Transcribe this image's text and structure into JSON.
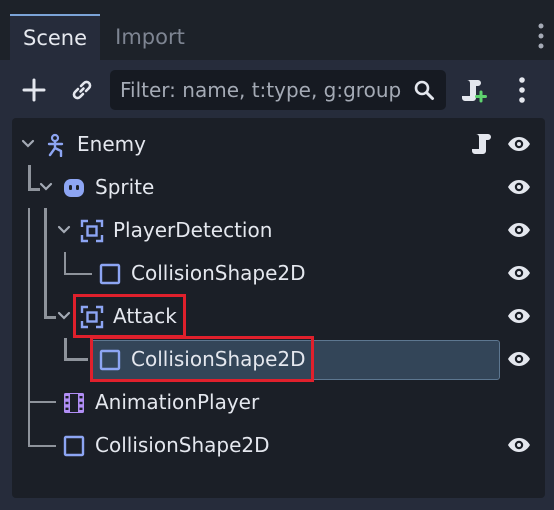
{
  "tabs": [
    {
      "label": "Scene",
      "active": true
    },
    {
      "label": "Import",
      "active": false
    }
  ],
  "toolbar": {
    "add_icon": "plus-icon",
    "link_icon": "link-icon",
    "filter_placeholder": "Filter: name, t:type, g:group",
    "search_icon": "search-icon",
    "add_script_icon": "add-script-icon",
    "menu_icon": "kebab-menu-icon"
  },
  "tree": {
    "nodes": [
      {
        "label": "Enemy",
        "type_icon": "character-body-icon",
        "has_script": true,
        "visible_toggle": true
      },
      {
        "label": "Sprite",
        "type_icon": "sprite-icon",
        "visible_toggle": true
      },
      {
        "label": "PlayerDetection",
        "type_icon": "area2d-icon",
        "visible_toggle": true
      },
      {
        "label": "CollisionShape2D",
        "type_icon": "collision-shape-icon",
        "visible_toggle": true
      },
      {
        "label": "Attack",
        "type_icon": "area2d-icon",
        "visible_toggle": true,
        "highlighted": true
      },
      {
        "label": "CollisionShape2D",
        "type_icon": "collision-shape-icon",
        "visible_toggle": true,
        "selected": true,
        "highlighted": true
      },
      {
        "label": "AnimationPlayer",
        "type_icon": "animation-player-icon",
        "visible_toggle": false
      },
      {
        "label": "CollisionShape2D",
        "type_icon": "collision-shape-icon",
        "visible_toggle": true
      }
    ]
  },
  "colors": {
    "accent": "#7ca4d8",
    "node_icon": "#8da5f3",
    "selection_bg": "#334558",
    "highlight_box": "#e0202c",
    "panel_bg": "#262c3b",
    "tree_bg": "#1b1f27"
  }
}
